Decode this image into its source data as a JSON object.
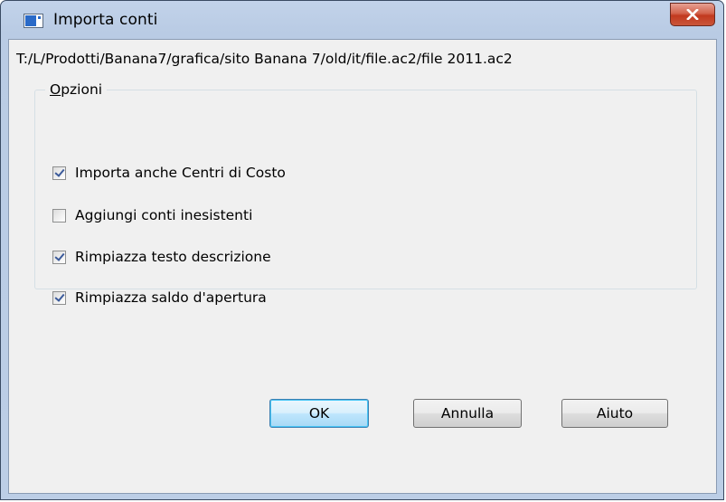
{
  "window": {
    "title": "Importa conti",
    "path": "T:/L/Prodotti/Banana7/grafica/sito Banana 7/old/it/file.ac2/file 2011.ac2"
  },
  "options": {
    "legend": "Opzioni",
    "items": [
      {
        "label": "Importa anche Centri di Costo",
        "checked": true
      },
      {
        "label": "Aggiungi conti inesistenti",
        "checked": false
      },
      {
        "label": "Rimpiazza testo descrizione",
        "checked": true
      },
      {
        "label": "Rimpiazza saldo d'apertura",
        "checked": true
      }
    ]
  },
  "buttons": {
    "ok": "OK",
    "cancel": "Annulla",
    "help": "Aiuto"
  },
  "icons": {
    "app": "window-app-icon",
    "close": "close-icon"
  },
  "colors": {
    "close_button": "#c9563a",
    "default_button_border": "#3c7fb1",
    "checkmark": "#3b5a9a"
  }
}
